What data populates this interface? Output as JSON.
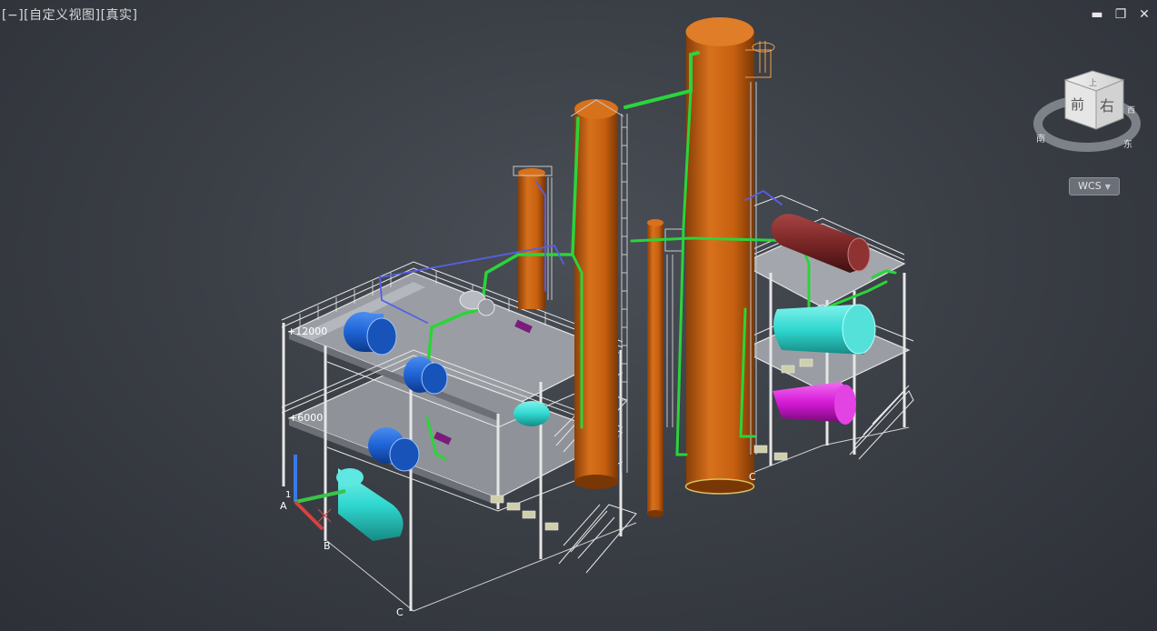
{
  "viewport": {
    "controls_label": "[−]",
    "view_label": "[自定义视图]",
    "style_label": "[真实]"
  },
  "window_controls": {
    "minimize": "▬",
    "restore": "❐",
    "close": "✕"
  },
  "viewcube": {
    "face_front": "前",
    "face_right": "右",
    "face_top": "上",
    "compass_south": "南",
    "compass_east": "东",
    "compass_west": "西"
  },
  "wcs_menu": {
    "label": "WCS",
    "arrow": "▼"
  },
  "ucs": {
    "x_label": "A",
    "y_label": "1",
    "z_label": ""
  },
  "model_labels": {
    "level_upper": "+12000",
    "level_lower": "+6000",
    "grid_b": "B",
    "grid_c_bottom": "C",
    "grid_c_right": "C"
  },
  "colors": {
    "background": "#3b3f46",
    "column_orange": "#c65f10",
    "pipe_green": "#2bd43a",
    "vessel_blue": "#1e63d6",
    "vessel_cyan": "#2fd8d0",
    "vessel_magenta": "#d61ad6",
    "vessel_brown": "#7a2626",
    "frame_white": "#e6e6e6",
    "floor_gray": "#9a9ea4"
  }
}
